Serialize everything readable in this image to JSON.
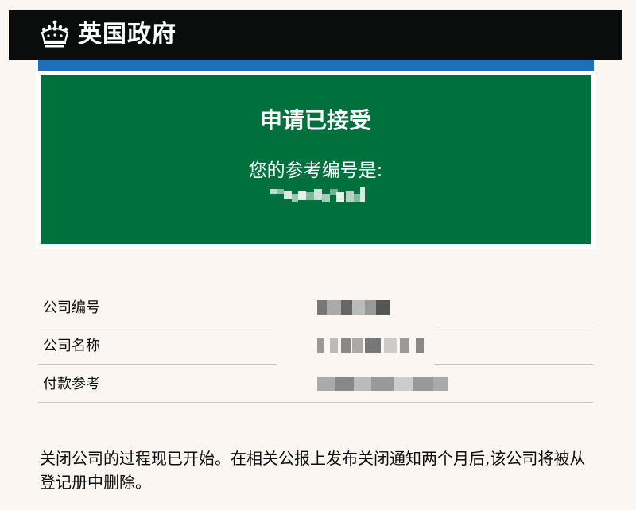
{
  "header": {
    "title": "英国政府",
    "logo_icon": "crown-icon"
  },
  "confirmation": {
    "title": "申请已接受",
    "reference_label": "您的参考编号是:",
    "reference_value_redacted": true
  },
  "summary": {
    "rows": [
      {
        "key": "公司编号",
        "value_redacted": true
      },
      {
        "key": "公司名称",
        "value_redacted": true
      },
      {
        "key": "付款参考",
        "value_redacted": true
      }
    ]
  },
  "body_text": "关闭公司的过程现已开始。在相关公报上发布关闭通知两个月后,该公司将被从登记册中删除。",
  "colors": {
    "header_bg": "#0b0c0c",
    "accent_blue": "#1d70b8",
    "panel_green": "#00703c",
    "page_bg": "#fbf6f2"
  }
}
